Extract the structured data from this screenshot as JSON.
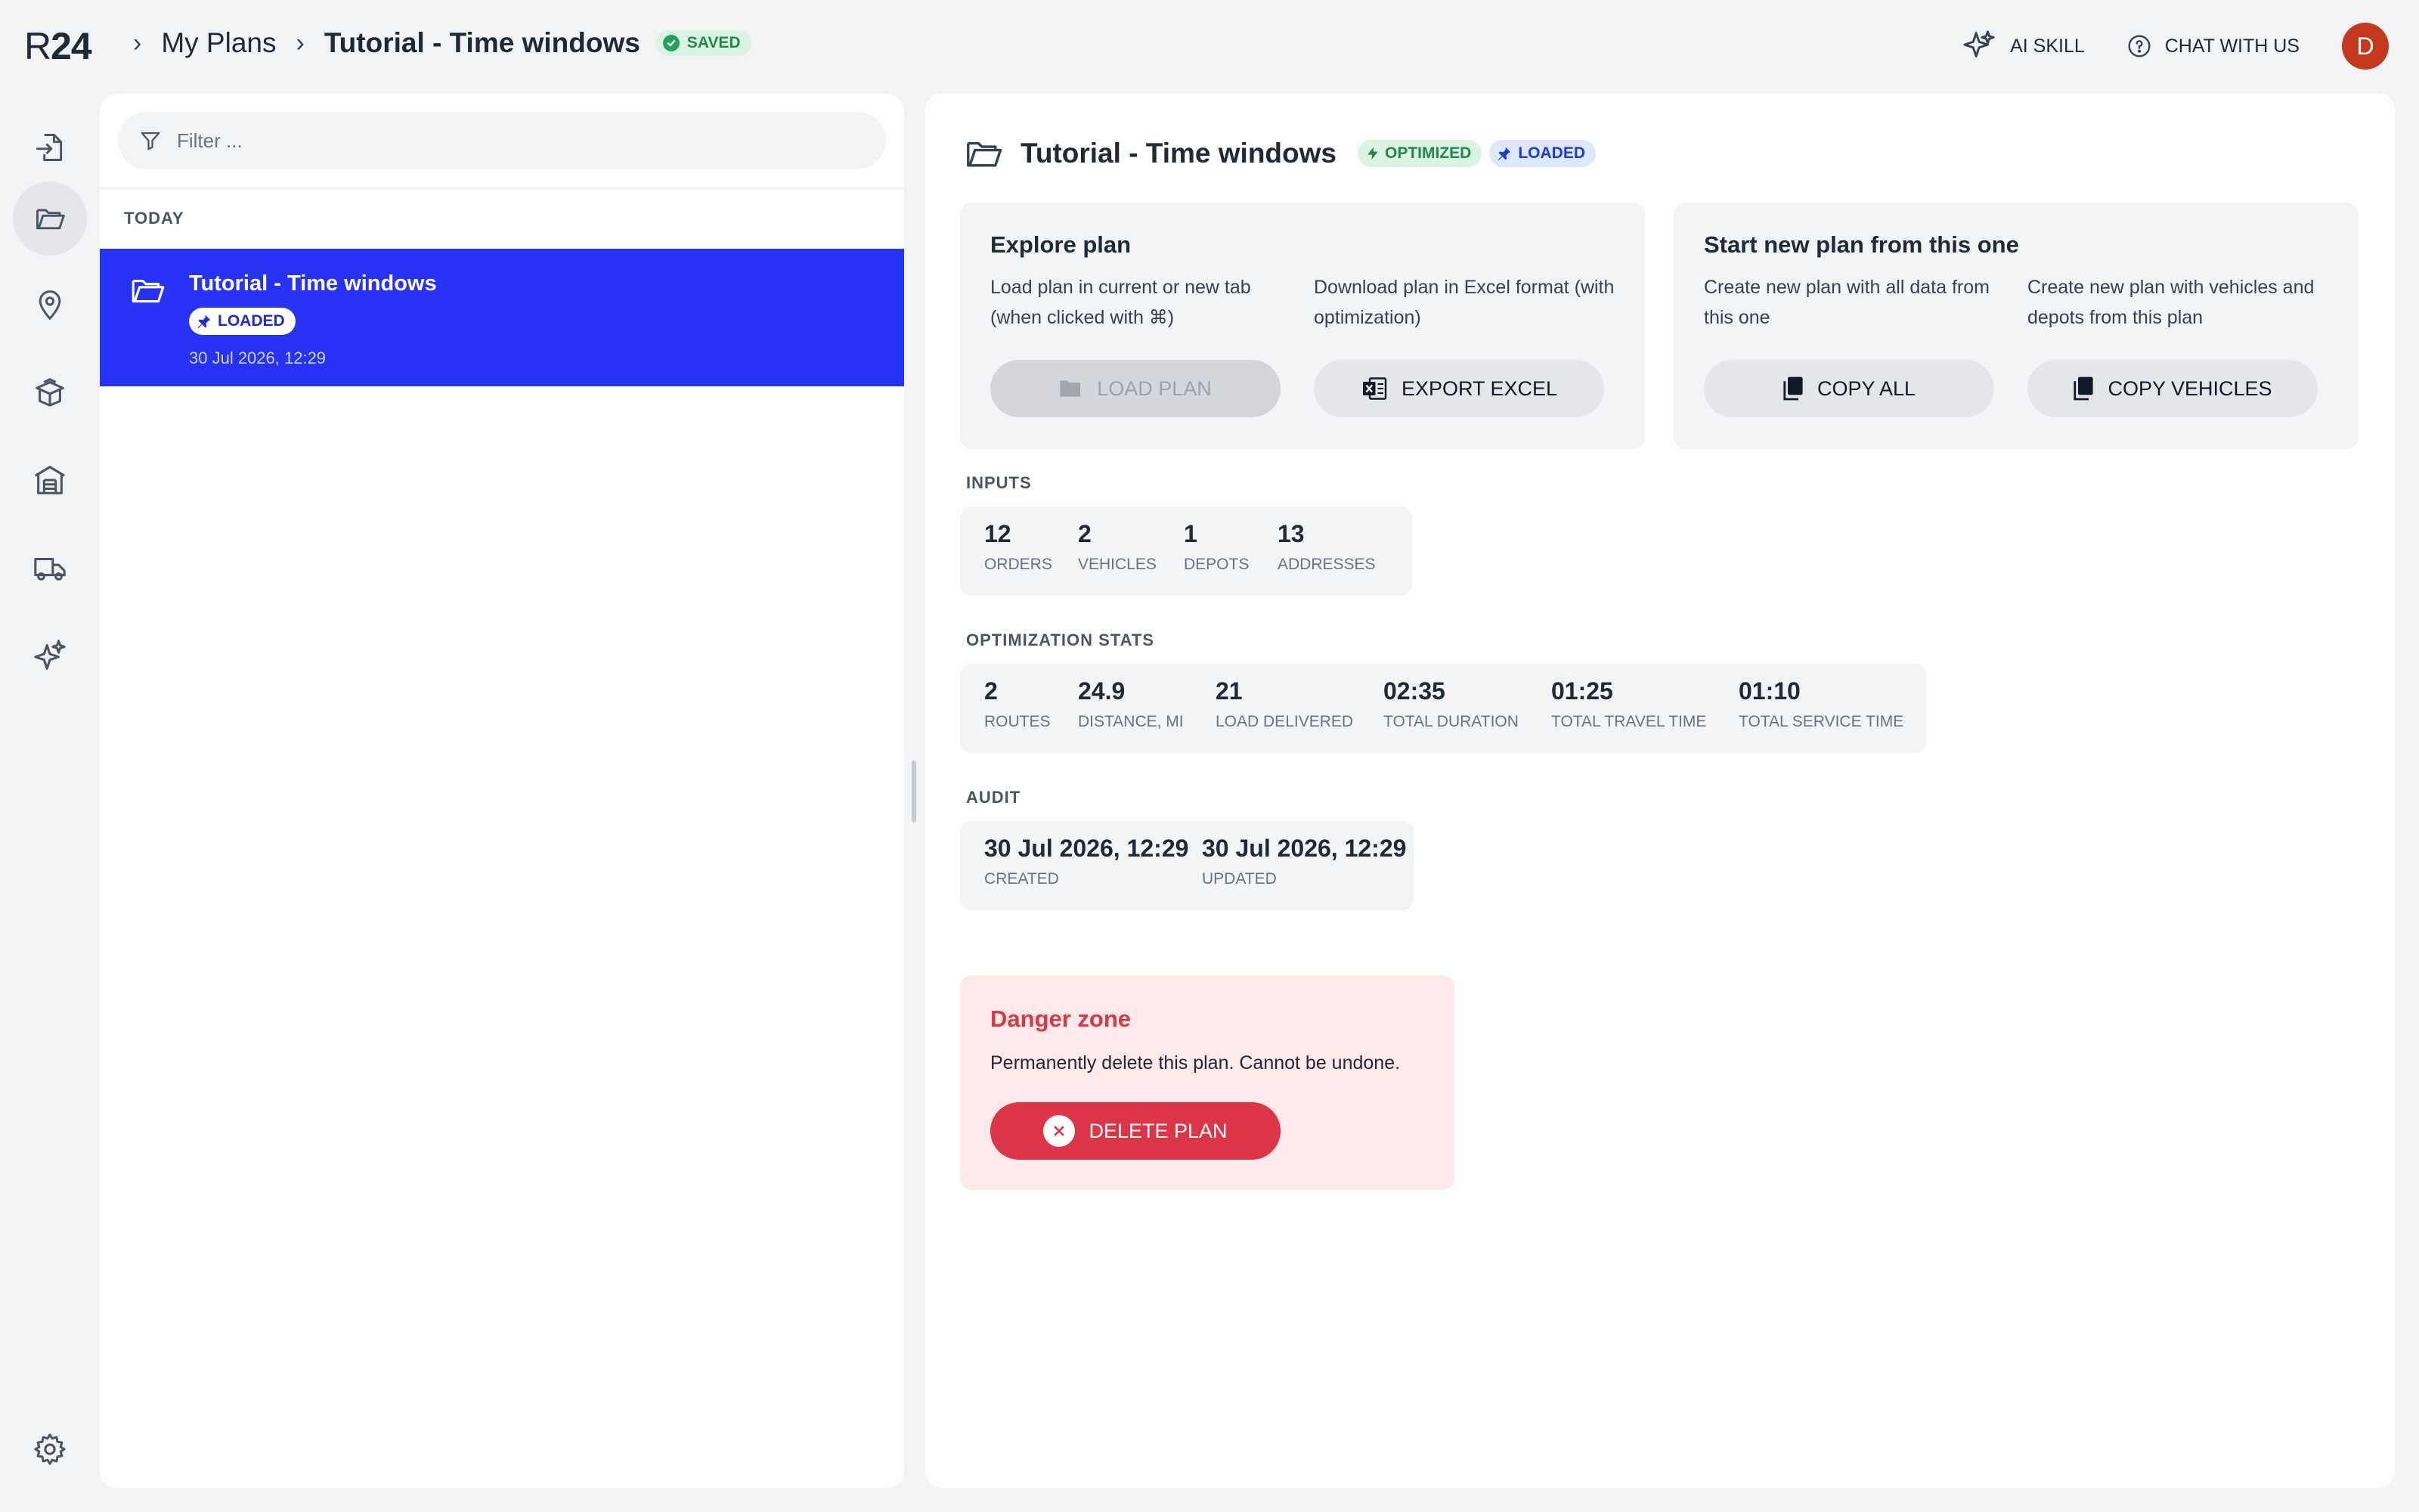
{
  "app": {
    "logo_r": "R",
    "logo_num": "24"
  },
  "breadcrumb": {
    "parent": "My Plans",
    "current": "Tutorial - Time windows",
    "status": "SAVED"
  },
  "top_actions": {
    "ai_skill": "AI SKILL",
    "chat": "CHAT WITH US",
    "avatar_initial": "D"
  },
  "sidebar": {
    "items": [
      {
        "icon": "import-icon"
      },
      {
        "icon": "folder-icon",
        "active": true
      },
      {
        "icon": "location-pin-icon"
      },
      {
        "icon": "package-icon"
      },
      {
        "icon": "warehouse-icon"
      },
      {
        "icon": "truck-icon"
      },
      {
        "icon": "sparkle-icon"
      }
    ],
    "bottom": {
      "icon": "gear-icon"
    }
  },
  "plans_panel": {
    "filter_placeholder": "Filter ...",
    "group_label": "TODAY",
    "plans": [
      {
        "title": "Tutorial - Time windows",
        "badge": "LOADED",
        "date": "30 Jul 2026, 12:29",
        "selected": true
      }
    ]
  },
  "main": {
    "title": "Tutorial - Time windows",
    "badges": {
      "optimized": "OPTIMIZED",
      "loaded": "LOADED"
    },
    "explore": {
      "title": "Explore plan",
      "load_desc": "Load plan in current or new tab (when clicked with ⌘)",
      "download_desc": "Download plan in Excel format (with optimization)",
      "load_button": "LOAD PLAN",
      "export_button": "EXPORT EXCEL"
    },
    "start_new": {
      "title": "Start new plan from this one",
      "copy_all_desc": "Create new plan with all data from this one",
      "copy_vehicles_desc": "Create new plan with vehicles and depots from this plan",
      "copy_all_button": "COPY ALL",
      "copy_vehicles_button": "COPY VEHICLES"
    },
    "inputs": {
      "label": "INPUTS",
      "stats": [
        {
          "value": "12",
          "label": "ORDERS"
        },
        {
          "value": "2",
          "label": "VEHICLES"
        },
        {
          "value": "1",
          "label": "DEPOTS"
        },
        {
          "value": "13",
          "label": "ADDRESSES"
        }
      ]
    },
    "optimization": {
      "label": "OPTIMIZATION STATS",
      "stats": [
        {
          "value": "2",
          "label": "ROUTES"
        },
        {
          "value": "24.9",
          "label": "DISTANCE, MI"
        },
        {
          "value": "21",
          "label": "LOAD DELIVERED"
        },
        {
          "value": "02:35",
          "label": "TOTAL DURATION"
        },
        {
          "value": "01:25",
          "label": "TOTAL TRAVEL TIME"
        },
        {
          "value": "01:10",
          "label": "TOTAL SERVICE TIME"
        }
      ]
    },
    "audit": {
      "label": "AUDIT",
      "stats": [
        {
          "value": "30 Jul 2026, 12:29",
          "label": "CREATED"
        },
        {
          "value": "30 Jul 2026, 12:29",
          "label": "UPDATED"
        }
      ]
    },
    "danger": {
      "title": "Danger zone",
      "desc": "Permanently delete this plan. Cannot be undone.",
      "button": "DELETE PLAN"
    }
  },
  "colors": {
    "accent": "#2633f5",
    "success": "#1f8a4c",
    "danger": "#dc3545",
    "avatar": "#c53a1e"
  }
}
